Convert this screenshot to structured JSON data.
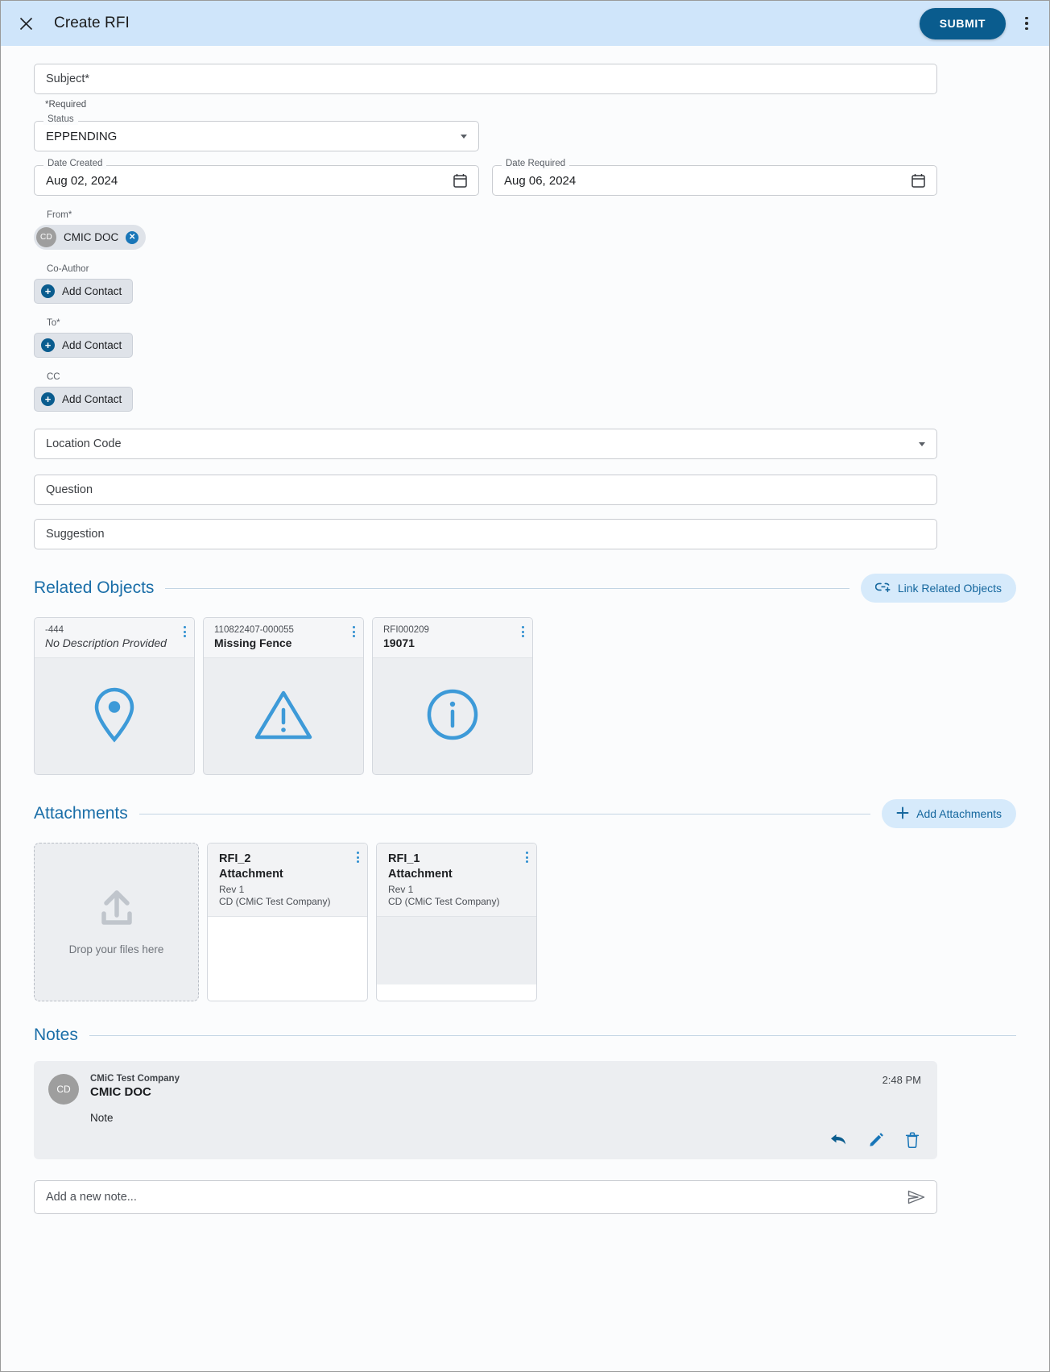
{
  "header": {
    "close_icon": "close-icon",
    "title": "Create RFI",
    "submit_label": "SUBMIT",
    "menu_icon": "more-vertical-icon"
  },
  "colors": {
    "header_bg": "#cfe5fa",
    "accent": "#0a5c8e",
    "section_title": "#1a6ea8",
    "pill_bg": "#d6eafb",
    "card_icon": "#3d9ad8"
  },
  "form": {
    "subject": {
      "placeholder": "Subject*",
      "value": ""
    },
    "required_note": "*Required",
    "status": {
      "label": "Status",
      "value": "EPPENDING"
    },
    "date_created": {
      "label": "Date Created",
      "value": "Aug 02, 2024"
    },
    "date_required": {
      "label": "Date Required",
      "value": "Aug 06, 2024"
    },
    "from": {
      "label": "From*",
      "chip": {
        "initials": "CD",
        "name": "CMIC DOC",
        "remove_icon": "close-circle-icon"
      }
    },
    "co_author": {
      "label": "Co-Author",
      "add_label": "Add Contact"
    },
    "to": {
      "label": "To*",
      "add_label": "Add Contact"
    },
    "cc": {
      "label": "CC",
      "add_label": "Add Contact"
    },
    "location_code": {
      "placeholder": "Location Code",
      "value": ""
    },
    "question": {
      "placeholder": "Question",
      "value": ""
    },
    "suggestion": {
      "placeholder": "Suggestion",
      "value": ""
    }
  },
  "related_objects": {
    "title": "Related Objects",
    "button_label": "Link Related Objects",
    "button_icon": "link-add-icon",
    "cards": [
      {
        "code": "-444",
        "description": "No Description Provided",
        "italic": true,
        "icon": "location-pin-icon"
      },
      {
        "code": "110822407-000055",
        "description": "Missing Fence",
        "italic": false,
        "icon": "warning-triangle-icon"
      },
      {
        "code": "RFI000209",
        "description": "19071",
        "italic": false,
        "icon": "info-circle-icon"
      }
    ]
  },
  "attachments": {
    "title": "Attachments",
    "button_label": "Add Attachments",
    "button_icon": "plus-icon",
    "dropzone": {
      "text": "Drop your files here",
      "icon": "upload-icon"
    },
    "cards": [
      {
        "name": "RFI_2",
        "type": "Attachment",
        "rev": "Rev 1",
        "owner": "CD (CMiC Test Company)"
      },
      {
        "name": "RFI_1",
        "type": "Attachment",
        "rev": "Rev 1",
        "owner": "CD (CMiC Test Company)"
      }
    ]
  },
  "notes": {
    "title": "Notes",
    "items": [
      {
        "initials": "CD",
        "company": "CMiC Test Company",
        "author": "CMIC DOC",
        "text": "Note",
        "time": "2:48 PM",
        "actions": [
          "reply-icon",
          "edit-icon",
          "delete-icon"
        ]
      }
    ],
    "new_note": {
      "placeholder": "Add a new note...",
      "send_icon": "send-icon"
    }
  }
}
